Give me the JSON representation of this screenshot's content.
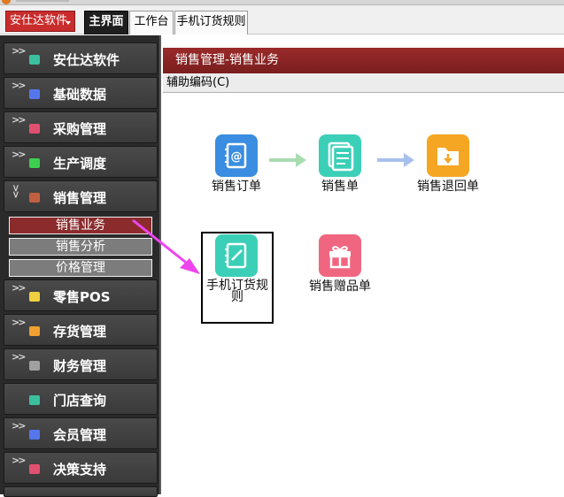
{
  "toolbar": {
    "app_menu": "安仕达软件",
    "tabs": [
      {
        "label": "主界面",
        "active": true
      },
      {
        "label": "工作台",
        "active": false
      },
      {
        "label": "手机订货规则",
        "active": false
      }
    ]
  },
  "sidebar": {
    "items": [
      {
        "label": "安仕达软件",
        "icon": "teal-cube-icon",
        "color": "#3bbf9e"
      },
      {
        "label": "基础数据",
        "icon": "blue-cube-icon",
        "color": "#5577ee"
      },
      {
        "label": "采购管理",
        "icon": "red-cube-icon",
        "color": "#e05070"
      },
      {
        "label": "生产调度",
        "icon": "green-cube-icon",
        "color": "#3ccf50"
      },
      {
        "label": "销售管理",
        "icon": "brown-cube-icon",
        "color": "#c06040"
      },
      {
        "label": "零售POS",
        "icon": "yellow-cube-icon",
        "color": "#f0d040"
      },
      {
        "label": "存货管理",
        "icon": "orange-cube-icon",
        "color": "#f0a030"
      },
      {
        "label": "财务管理",
        "icon": "gray-cube-icon",
        "color": "#a0a0a0"
      },
      {
        "label": "门店查询",
        "icon": "teal-cube-icon",
        "color": "#3bbf9e"
      },
      {
        "label": "会员管理",
        "icon": "blue-cube-icon",
        "color": "#5577ee"
      },
      {
        "label": "决策支持",
        "icon": "red-cube-icon",
        "color": "#e05070"
      }
    ],
    "sales_submenu": [
      {
        "label": "销售业务",
        "active": true
      },
      {
        "label": "销售分析",
        "active": false
      },
      {
        "label": "价格管理",
        "active": false
      }
    ]
  },
  "main": {
    "title": "销售管理-销售业务",
    "helper": "辅助编码(C)",
    "modules": [
      {
        "label": "销售订单",
        "icon": "contact-book-icon",
        "color": "#3a8de0"
      },
      {
        "label": "销售单",
        "icon": "document-icon",
        "color": "#3bcfb8"
      },
      {
        "label": "销售退回单",
        "icon": "folder-download-icon",
        "color": "#f5a623"
      },
      {
        "label": "手机订货规则",
        "icon": "notebook-edit-icon",
        "color": "#3bcfb8"
      },
      {
        "label": "销售赠品单",
        "icon": "gift-icon",
        "color": "#f06680"
      }
    ],
    "annotation_arrow_color": "#ee44ee"
  }
}
